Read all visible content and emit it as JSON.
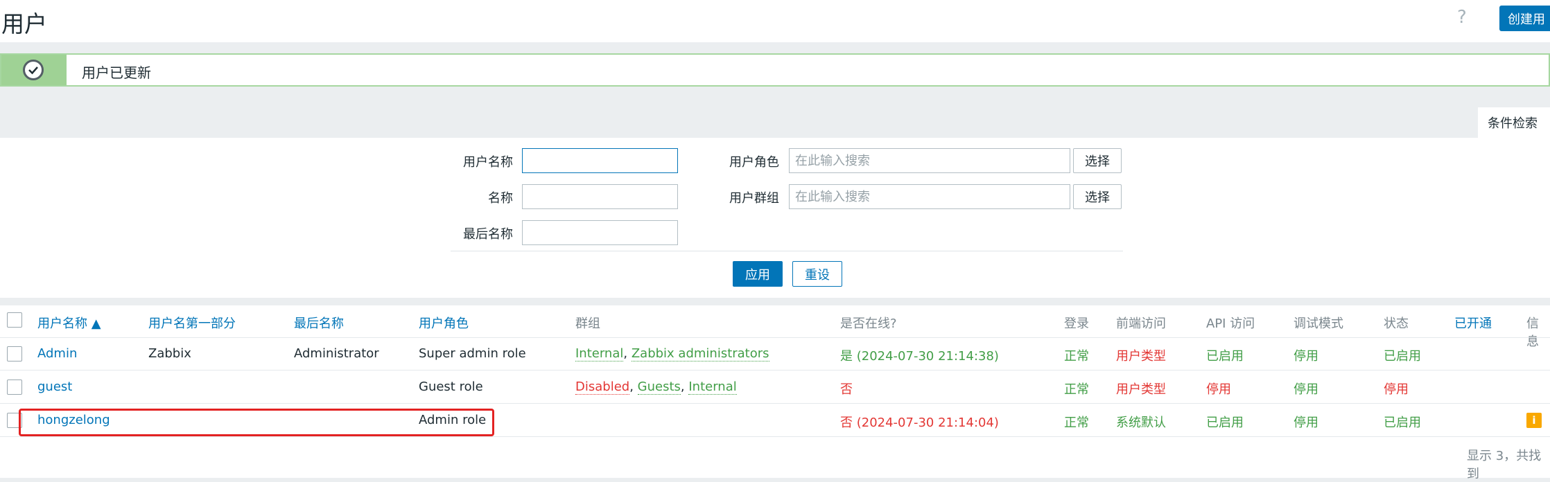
{
  "header": {
    "title": "用户",
    "help_icon": "?",
    "create_label": "创建用"
  },
  "message": {
    "text": "用户已更新",
    "icon": "check-circle-icon"
  },
  "filter": {
    "tab_label": "条件检索",
    "username_label": "用户名称",
    "username_value": "",
    "name_label": "名称",
    "surname_label": "最后名称",
    "role_label": "用户角色",
    "role_placeholder": "在此输入搜索",
    "group_label": "用户群组",
    "group_placeholder": "在此输入搜索",
    "select_label": "选择",
    "apply_label": "应用",
    "reset_label": "重设"
  },
  "table": {
    "columns": [
      "用户名称 ▲",
      "用户名第一部分",
      "最后名称",
      "用户角色",
      "群组",
      "是否在线?",
      "登录",
      "前端访问",
      "API 访问",
      "调试模式",
      "状态",
      "已开通",
      "信息"
    ],
    "rows": [
      {
        "username": "Admin",
        "name": "Zabbix",
        "surname": "Administrator",
        "role": "Super admin role",
        "groups": [
          "Internal",
          "Zabbix administrators"
        ],
        "groups_sep": ", ",
        "online": "是 (2024-07-30 21:14:38)",
        "login": "正常",
        "frontend": "用户类型",
        "api": "已启用",
        "debug": "停用",
        "status": "已启用"
      },
      {
        "username": "guest",
        "name": "",
        "surname": "",
        "role": "Guest role",
        "groups": [
          "Disabled",
          "Guests",
          "Internal"
        ],
        "groups_sep": ", ",
        "online": "否",
        "login": "正常",
        "frontend": "用户类型",
        "api": "停用",
        "debug": "停用",
        "status": "停用"
      },
      {
        "username": "hongzelong",
        "name": "",
        "surname": "",
        "role": "Admin role",
        "groups": [],
        "online": "否 (2024-07-30 21:14:04)",
        "login": "正常",
        "frontend": "系统默认",
        "api": "已启用",
        "debug": "停用",
        "status": "已启用",
        "info_icon": "i"
      }
    ],
    "footer": "显示 3，共找到"
  }
}
